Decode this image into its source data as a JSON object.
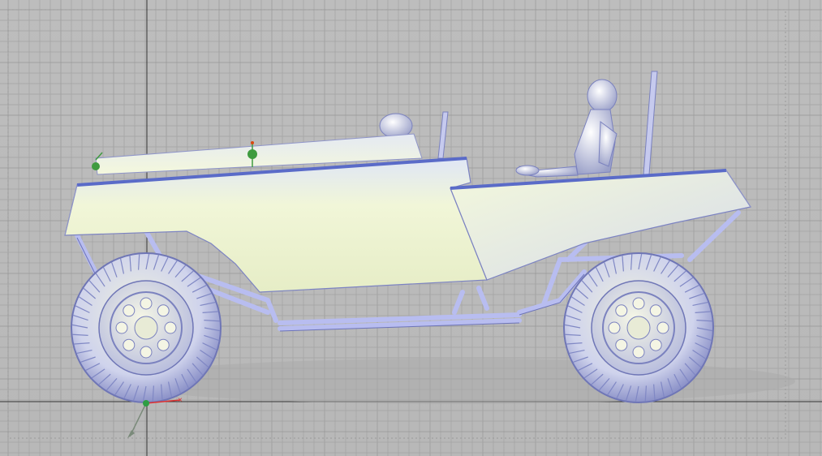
{
  "viewport": {
    "background_color": "#bababa",
    "grid_color": "#a3a3a3",
    "grid_major_color": "#979797",
    "axis_color": "#333333"
  },
  "model": {
    "body_color": "#eef3cf",
    "body_shade_color": "#c9ccd8",
    "trim_color": "#5a6bc8",
    "tube_color": "#b8bdf0",
    "tire_color": "#d3d6ea",
    "marker_color": "#3f9b3f",
    "parts": [
      {
        "name": "front-body-panel"
      },
      {
        "name": "rear-body-panel"
      },
      {
        "name": "roll-cage"
      },
      {
        "name": "front-wheel"
      },
      {
        "name": "rear-wheel"
      },
      {
        "name": "driver-figure"
      },
      {
        "name": "passenger-head"
      },
      {
        "name": "rear-pole"
      }
    ]
  },
  "triad": {
    "icon": "axis-triad-icon",
    "x_color": "#e03131",
    "y_color": "#2f9e44"
  }
}
